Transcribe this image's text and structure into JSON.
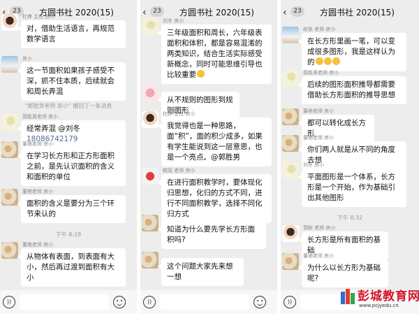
{
  "chat_title": "方圆书社 2020(15)",
  "unread_badge": "23",
  "panel1": {
    "m1_sender": "杜婷 主任 房小",
    "m1_text": "对，借助生活语言，再规范数学语言",
    "m2_sender": "房小",
    "m2_text": "这一节面积如果孩子感受不深，抓不住本质，后续就会和周长弄混",
    "recall": "\"郭胜男老师 房小\" 撤回了一条消息",
    "m3_sender": "郭胜男老师 房小",
    "m3_text": "经常弄混 @刘冬 ",
    "m3_phone": "18086742179",
    "m4_sender": "董艳老师 房小",
    "m4_text": "在学习长方形和正方形面积之前，是先认识面积的含义和面积的单位",
    "m5_sender": "董艳老师 房小",
    "m5_text": "面积的含义是要分为三个环节来认的",
    "time": "下午 8:28",
    "m6_sender": "董艳老师 房小",
    "m6_text": "从物体有表面，到表面有大小，然后再过渡到面积有大小"
  },
  "panel2": {
    "m1_sender": "刘冬 房小",
    "m1_text": "三年级面积和周长，六年级表面积和体积，都是容易混淆的两类知识，结合生活实际感受新概念，同时可能思维引导也比较重要",
    "m2_sender": "",
    "m2_text": "从不规则的图形到规则图形",
    "m3_sender": "杜婷 主任 房小",
    "m3_text": "我觉得也是一种思路，面“积”，面的积少成多，如果有学生能说到这一层意思，也是一个亮点。@郭胜男",
    "m4_sender": "韩双 老师 房小",
    "m4_text": "在进行面积教学时，要体现化归思想，化归的方式不同，进行不同面积教学，选择不同化归方式",
    "m5_sender": "",
    "m5_text": "知道为什么要先学长方形面积吗?",
    "m6_sender": "",
    "m6_text": "这个问题大家先来想一想"
  },
  "panel3": {
    "m1_sender": "权依 老师 房小",
    "m1_text": "在长方形里画一笔，可以变成很多图形，我是这样认为的",
    "m2_sender": "郭胜男老师 房小",
    "m2_text": "后续的图形面积推导都需要借助长方形面积的推导思想",
    "m3_sender": "董艳老师 房小",
    "m3_text": "都可以转化成长方形",
    "m4_sender": "董艳老师 房小",
    "m4_text": "你们两人就是从不同的角度去想",
    "m5_sender": "刘冬 房小",
    "m5_text": "平面图形是一个体系，长方形是一个开始，作为基础引出其他图形",
    "time": "下午 8:32",
    "m6_sender": "郭盼 老师 房小",
    "m6_text": "长方形是所有面积的基础",
    "m7_sender": "董艳老师 房小",
    "m7_text": "为什么以长方形为基础呢?"
  },
  "watermark": {
    "name": "彭城教育网",
    "url": "www.pcjyedu.cn"
  },
  "colors": {
    "bubble": "#ffffff",
    "background": "#ededed",
    "link": "#576b95",
    "watermark": "#d4162b"
  },
  "icons": [
    "back-chevron-icon",
    "voice-icon",
    "emoji-icon",
    "plus-icon",
    "avatar-icon"
  ]
}
